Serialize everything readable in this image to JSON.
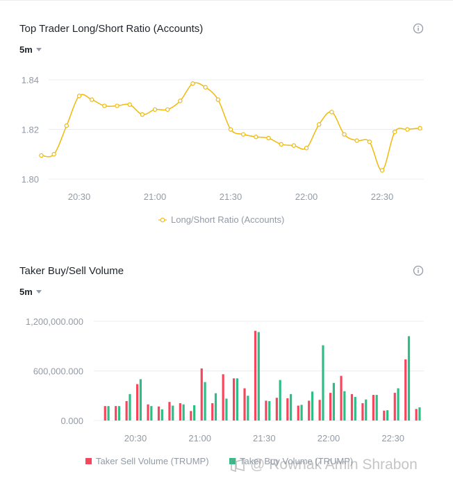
{
  "panels": [
    {
      "title": "Top Trader Long/Short Ratio (Accounts)",
      "interval": "5m",
      "legend": "Long/Short Ratio (Accounts)"
    },
    {
      "title": "Taker Buy/Sell Volume",
      "interval": "5m",
      "legend_sell": "Taker Sell Volume (TRUMP)",
      "legend_buy": "Taker Buy Volume (TRUMP)"
    }
  ],
  "watermark": "@ Rownak Amin Shrabon",
  "colors": {
    "ratio_line": "#F0B90B",
    "sell": "#F6465D",
    "buy": "#2EBD85",
    "axis_text": "#929AA5",
    "grid": "#EAECEF"
  },
  "chart_data": [
    {
      "type": "line",
      "title": "Top Trader Long/Short Ratio (Accounts)",
      "x": [
        "20:15",
        "20:20",
        "20:25",
        "20:30",
        "20:35",
        "20:40",
        "20:45",
        "20:50",
        "20:55",
        "21:00",
        "21:05",
        "21:10",
        "21:15",
        "21:20",
        "21:25",
        "21:30",
        "21:35",
        "21:40",
        "21:45",
        "21:50",
        "21:55",
        "22:00",
        "22:05",
        "22:10",
        "22:15",
        "22:20",
        "22:25",
        "22:30",
        "22:35",
        "22:40",
        "22:45"
      ],
      "series": [
        {
          "name": "Long/Short Ratio (Accounts)",
          "values": [
            1.8095,
            1.81,
            1.8215,
            1.8335,
            1.832,
            1.8295,
            1.8295,
            1.83,
            1.826,
            1.828,
            1.828,
            1.8315,
            1.8385,
            1.837,
            1.832,
            1.82,
            1.818,
            1.817,
            1.8165,
            1.814,
            1.8135,
            1.8125,
            1.822,
            1.827,
            1.818,
            1.8155,
            1.815,
            1.8035,
            1.819,
            1.82,
            1.8205
          ]
        }
      ],
      "xticks": [
        "20:30",
        "21:00",
        "21:30",
        "22:00",
        "22:30"
      ],
      "yticks": [
        "1.80",
        "1.82",
        "1.84"
      ],
      "ylim": [
        1.8,
        1.84
      ],
      "grid": true,
      "legend": "bottom-center"
    },
    {
      "type": "bar",
      "title": "Taker Buy/Sell Volume",
      "categories": [
        "20:15",
        "20:20",
        "20:25",
        "20:30",
        "20:35",
        "20:40",
        "20:45",
        "20:50",
        "20:55",
        "21:00",
        "21:05",
        "21:10",
        "21:15",
        "21:20",
        "21:25",
        "21:30",
        "21:35",
        "21:40",
        "21:45",
        "21:50",
        "21:55",
        "22:00",
        "22:05",
        "22:10",
        "22:15",
        "22:20",
        "22:25",
        "22:30",
        "22:35",
        "22:40"
      ],
      "series": [
        {
          "name": "Taker Sell Volume (TRUMP)",
          "values": [
            175000,
            175000,
            235000,
            440000,
            195000,
            170000,
            225000,
            210000,
            115000,
            630000,
            210000,
            560000,
            510000,
            390000,
            1085000,
            240000,
            275000,
            270000,
            180000,
            240000,
            250000,
            335000,
            540000,
            320000,
            210000,
            310000,
            120000,
            335000,
            740000,
            140000
          ]
        },
        {
          "name": "Taker Buy Volume (TRUMP)",
          "values": [
            175000,
            175000,
            320000,
            500000,
            175000,
            135000,
            180000,
            195000,
            185000,
            465000,
            330000,
            265000,
            510000,
            300000,
            1070000,
            235000,
            490000,
            320000,
            190000,
            350000,
            910000,
            455000,
            355000,
            285000,
            255000,
            310000,
            125000,
            390000,
            1020000,
            160000
          ]
        }
      ],
      "xticks": [
        "20:30",
        "21:00",
        "21:30",
        "22:00",
        "22:30"
      ],
      "yticks": [
        "0.000",
        "600,000.000",
        "1,200,000.000"
      ],
      "ylim": [
        0,
        1200000
      ],
      "grid": true,
      "legend": "bottom-center"
    }
  ]
}
